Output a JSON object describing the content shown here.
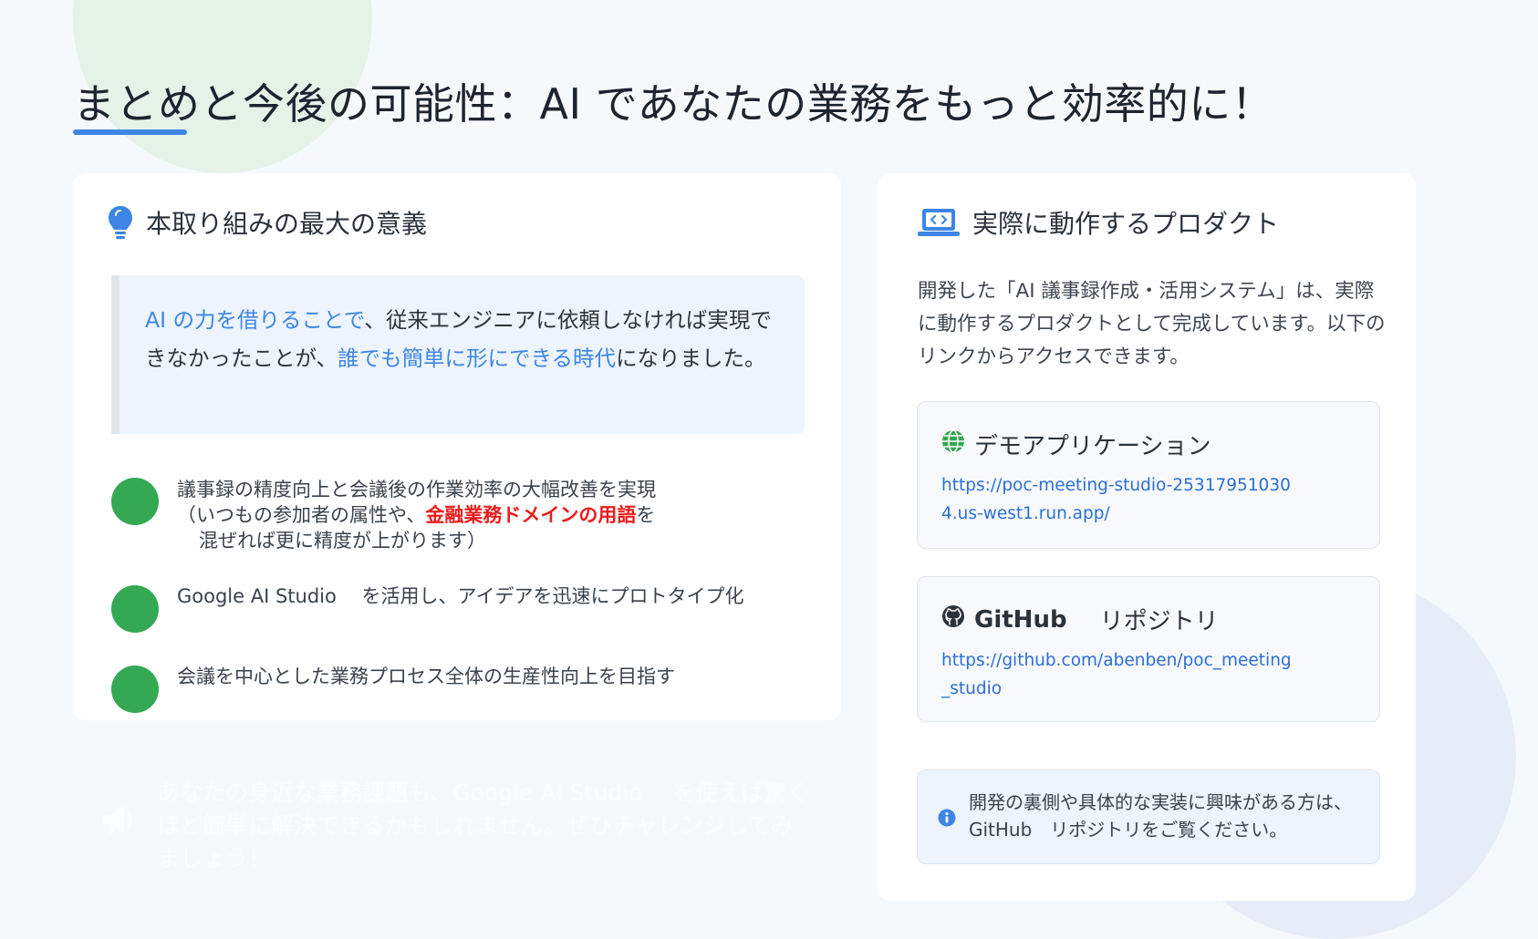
{
  "title": "まとめと今後の可能性：AI であなたの業務をもっと効率的に！",
  "left_card": {
    "heading": "本取り組みの最大の意義",
    "quote": {
      "part1_highlight": "AI の力を借りることで",
      "part2": "、従来エンジニアに依頼しなければ実現できなかったことが、",
      "part3_highlight": "誰でも簡単に形にできる時代",
      "part4": "になりました。"
    },
    "bullets": [
      {
        "line1": "議事録の精度向上と会議後の作業効率の大幅改善を実現",
        "line2_pre": "（いつもの参加者の属性や、",
        "line2_red": "金融業務ドメインの用語",
        "line2_post": "を",
        "line3": "混ぜれば更に精度が上がります）"
      },
      {
        "text": "Google AI Studio　 を活用し、アイデアを迅速にプロトタイプ化"
      },
      {
        "text": "会議を中心とした業務プロセス全体の生産性向上を目指す"
      }
    ]
  },
  "faint_callout": "あなたの身近な業務課題も、Google AI Studio　 を使えば驚くほど簡単に解決できるかもしれません。ぜひチャレンジしてみましょう！",
  "right_card": {
    "heading": "実際に動作するプロダクト",
    "intro": "開発した「AI 議事録作成・活用システム」は、実際に動作するプロダクトとして完成しています。以下のリンクからアクセスできます。",
    "demo": {
      "title": "デモアプリケーション",
      "url": "https://poc-meeting-studio-253179510304.us-west1.run.app/"
    },
    "github": {
      "title_bold": "GitHub",
      "title_rest": "　リポジトリ",
      "url": "https://github.com/abenben/poc_meeting_studio"
    },
    "info": {
      "line1": "開発の裏側や具体的な実装に興味がある方は、",
      "line2": "GitHub　リポジトリをご覧ください。"
    }
  },
  "colors": {
    "accent_blue": "#3d86e6",
    "bullet_green": "#34a853",
    "emphasis_red": "#ea1c1c"
  }
}
